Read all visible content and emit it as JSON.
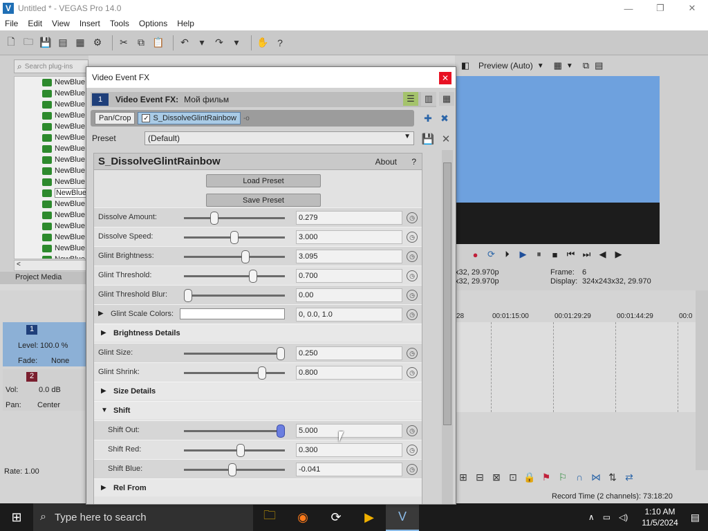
{
  "window": {
    "title": "Untitled * - VEGAS Pro 14.0",
    "minimize": "—",
    "restore": "❐",
    "close": "✕"
  },
  "menu": [
    "File",
    "Edit",
    "View",
    "Insert",
    "Tools",
    "Options",
    "Help"
  ],
  "explorer": {
    "search_placeholder": "Search plug-ins",
    "items": [
      "NewBlue",
      "NewBlue",
      "NewBlue",
      "NewBlue",
      "NewBlue",
      "NewBlue",
      "NewBlue",
      "NewBlue",
      "NewBlue",
      "NewBlue",
      "NewBlue",
      "NewBlue",
      "NewBlue",
      "NewBlue",
      "NewBlue",
      "NewBlue",
      "NewBlue"
    ],
    "selected_index": 10,
    "tab": "Project Media"
  },
  "preview": {
    "mode": "Preview (Auto)",
    "info_left_1": "x32, 29.970p",
    "info_left_2": "x32, 29.970p",
    "frame_label": "Frame:",
    "frame_value": "6",
    "display_label": "Display:",
    "display_value": "324x243x32, 29.970"
  },
  "tracks": {
    "track1": {
      "number": "1",
      "level_label": "Level:",
      "level_value": "100.0 %",
      "fade_label": "Fade:",
      "fade_value": "None"
    },
    "track2": {
      "number": "2",
      "vol_label": "Vol:",
      "vol_value": "0.0 dB",
      "pan_label": "Pan:",
      "pan_value": "Center"
    }
  },
  "ruler": [
    "28",
    "00:01:15:00",
    "00:01:29:29",
    "00:01:44:29",
    "00:0"
  ],
  "status": {
    "rate": "Rate: 1.00",
    "record_time": "Record Time (2 channels): 73:18:20"
  },
  "dialog": {
    "title": "Video Event FX",
    "chain_number": "1",
    "chain_label": "Video Event FX:",
    "chain_name": "Мой фильм",
    "chain": [
      {
        "label": "Pan/Crop",
        "checked": false
      },
      {
        "label": "S_DissolveGlintRainbow",
        "checked": true
      }
    ],
    "preset_label": "Preset",
    "preset_value": "(Default)",
    "fx_name": "S_DissolveGlintRainbow",
    "about": "About",
    "help": "?",
    "load_preset": "Load Preset",
    "save_preset": "Save Preset",
    "params": [
      {
        "label": "Dissolve Amount:",
        "value": "0.279",
        "pos": 0.28
      },
      {
        "label": "Dissolve Speed:",
        "value": "3.000",
        "pos": 0.5
      },
      {
        "label": "Glint Brightness:",
        "value": "3.095",
        "pos": 0.62
      },
      {
        "label": "Glint Threshold:",
        "value": "0.700",
        "pos": 0.7
      },
      {
        "label": "Glint Threshold Blur:",
        "value": "0.00",
        "pos": 0.0
      }
    ],
    "glint_colors": {
      "label": "Glint Scale Colors:",
      "value": "0, 0.0, 1.0"
    },
    "sections": {
      "brightness": "Brightness Details",
      "size": "Size Details",
      "shift": "Shift",
      "relfrom": "Rel From"
    },
    "brightness_params": [
      {
        "label": "Glint Size:",
        "value": "0.250",
        "pos": 1.0
      },
      {
        "label": "Glint Shrink:",
        "value": "0.800",
        "pos": 0.8
      }
    ],
    "shift_params": [
      {
        "label": "Shift Out:",
        "value": "5.000",
        "pos": 1.0
      },
      {
        "label": "Shift Red:",
        "value": "0.300",
        "pos": 0.57
      },
      {
        "label": "Shift Blue:",
        "value": "-0.041",
        "pos": 0.48
      }
    ]
  },
  "taskbar": {
    "search_placeholder": "Type here to search",
    "time": "1:10 AM",
    "date": "11/5/2024"
  }
}
